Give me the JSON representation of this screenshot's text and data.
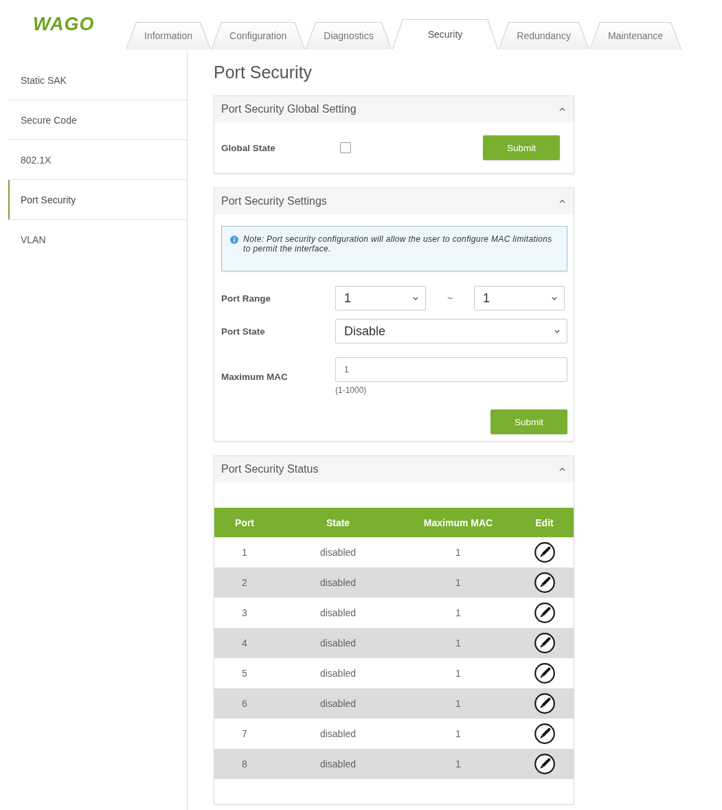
{
  "logo": "WAGO",
  "tabs": [
    {
      "label": "Information",
      "selected": false
    },
    {
      "label": "Configuration",
      "selected": false
    },
    {
      "label": "Diagnostics",
      "selected": false
    },
    {
      "label": "Security",
      "selected": true
    },
    {
      "label": "Redundancy",
      "selected": false
    },
    {
      "label": "Maintenance",
      "selected": false
    }
  ],
  "sidebar": {
    "items": [
      {
        "label": "Static SAK",
        "selected": false
      },
      {
        "label": "Secure Code",
        "selected": false
      },
      {
        "label": "802.1X",
        "selected": false
      },
      {
        "label": "Port Security",
        "selected": true
      },
      {
        "label": "VLAN",
        "selected": false
      }
    ]
  },
  "page_title": "Port Security",
  "global_setting": {
    "title": "Port Security Global Setting",
    "expanded": true,
    "global_state": {
      "label": "Global State",
      "checked": false
    },
    "submit": "Submit"
  },
  "settings": {
    "title": "Port Security Settings",
    "expanded": true,
    "note": "Note: Port security configuration will allow the user to configure MAC limitations to permit the interface.",
    "port_range": {
      "label": "Port Range",
      "from": "1",
      "separator": "~",
      "to": "1"
    },
    "port_state": {
      "label": "Port State",
      "value": "Disable"
    },
    "maximum_mac": {
      "label": "Maximum MAC",
      "value": "1",
      "hint": "(1-1000)"
    },
    "submit": "Submit"
  },
  "status": {
    "title": "Port Security Status",
    "expanded": true,
    "table": {
      "columns": [
        "Port",
        "State",
        "Maximum MAC",
        "Edit"
      ],
      "rows": [
        {
          "port": "1",
          "state": "disabled",
          "maximum_mac": "1"
        },
        {
          "port": "2",
          "state": "disabled",
          "maximum_mac": "1"
        },
        {
          "port": "3",
          "state": "disabled",
          "maximum_mac": "1"
        },
        {
          "port": "4",
          "state": "disabled",
          "maximum_mac": "1"
        },
        {
          "port": "5",
          "state": "disabled",
          "maximum_mac": "1"
        },
        {
          "port": "6",
          "state": "disabled",
          "maximum_mac": "1"
        },
        {
          "port": "7",
          "state": "disabled",
          "maximum_mac": "1"
        },
        {
          "port": "8",
          "state": "disabled",
          "maximum_mac": "1"
        }
      ]
    }
  }
}
